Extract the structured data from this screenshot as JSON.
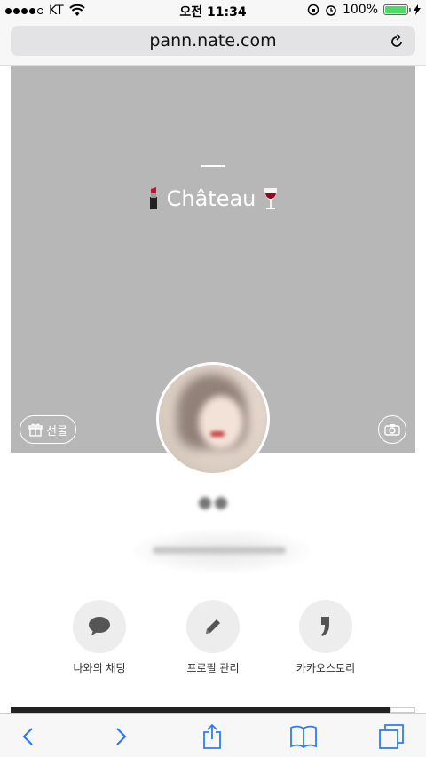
{
  "status_bar": {
    "carrier": "KT",
    "time": "오전 11:34",
    "battery": "100%"
  },
  "browser": {
    "url": "pann.nate.com"
  },
  "profile": {
    "cover_title": "Château",
    "gift_label": "선물"
  },
  "actions": [
    {
      "label": "나와의 채팅",
      "icon": "chat-bubble-icon"
    },
    {
      "label": "프로필 관리",
      "icon": "pencil-icon"
    },
    {
      "label": "카카오스토리",
      "icon": "kakaostory-icon"
    }
  ],
  "colors": {
    "cover_bg": "#b7b7b7",
    "action_bg": "#ededed",
    "action_icon": "#555555",
    "battery": "#4cd964",
    "ios_blue": "#2f7cf6"
  }
}
